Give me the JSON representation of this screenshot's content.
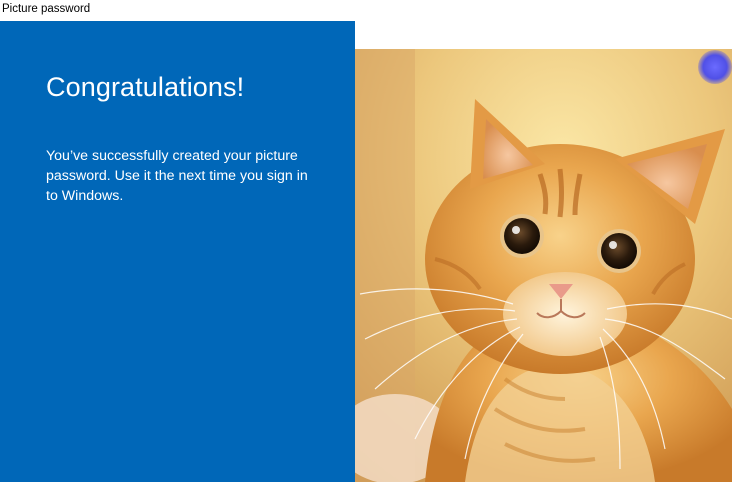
{
  "window": {
    "title": "Picture password"
  },
  "panel": {
    "heading": "Congratulations!",
    "message": "You’ve successfully created your picture password. Use it the next time you sign in to Windows.",
    "background_color": "#0067b8"
  },
  "picture": {
    "subject_icon": "cat-photo",
    "gesture_marker_color": "#5a5af0"
  }
}
